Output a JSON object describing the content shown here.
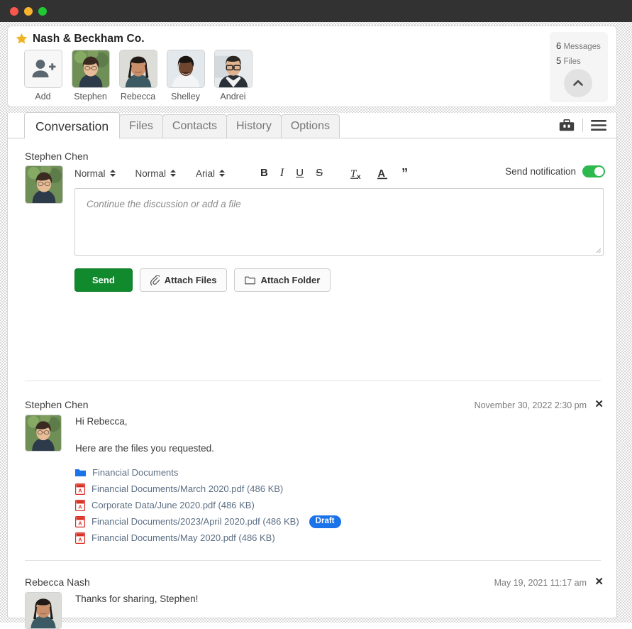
{
  "window": {
    "traffic_lights": [
      "close",
      "minimize",
      "maximize"
    ]
  },
  "header": {
    "star_icon": "star-icon",
    "company_name": "Nash & Beckham Co.",
    "people": [
      {
        "name": "Add",
        "type": "add-button",
        "icon": "add-person-icon"
      },
      {
        "name": "Stephen",
        "type": "avatar"
      },
      {
        "name": "Rebecca",
        "type": "avatar"
      },
      {
        "name": "Shelley",
        "type": "avatar"
      },
      {
        "name": "Andrei",
        "type": "avatar"
      }
    ],
    "counters": {
      "messages_count": "6",
      "messages_label": "Messages",
      "files_count": "5",
      "files_label": "Files",
      "collapse_icon": "chevron-up-icon"
    }
  },
  "tabs": [
    {
      "label": "Conversation",
      "active": true
    },
    {
      "label": "Files",
      "active": false
    },
    {
      "label": "Contacts",
      "active": false
    },
    {
      "label": "History",
      "active": false
    },
    {
      "label": "Options",
      "active": false
    }
  ],
  "tab_actions": {
    "toolbox_icon": "briefcase-icon",
    "menu_icon": "hamburger-menu-icon"
  },
  "composer": {
    "author": "Stephen Chen",
    "avatar_icon": "avatar-stephen",
    "toolbar": {
      "style_select": "Normal",
      "size_select": "Normal",
      "font_select": "Arial",
      "bold": "B",
      "italic": "I",
      "underline": "U",
      "strikethrough": "S",
      "clear_format": "Tx",
      "text_color": "A",
      "quote": "”"
    },
    "send_notification_label": "Send notification",
    "send_notification_on": true,
    "input_placeholder": "Continue the discussion or add a file",
    "input_value": "",
    "buttons": {
      "send": "Send",
      "attach_files": "Attach Files",
      "attach_folder": "Attach Folder"
    }
  },
  "messages": [
    {
      "author": "Stephen Chen",
      "timestamp": "November 30, 2022 2:30 pm",
      "close_icon": "close-icon",
      "lines": [
        "Hi Rebecca,",
        "Here are the files you requested."
      ],
      "attachments": [
        {
          "kind": "folder",
          "label": "Financial Documents",
          "badge": ""
        },
        {
          "kind": "pdf",
          "label": "Financial Documents/March 2020.pdf (486 KB)",
          "badge": ""
        },
        {
          "kind": "pdf",
          "label": "Corporate Data/June 2020.pdf (486 KB)",
          "badge": ""
        },
        {
          "kind": "pdf",
          "label": "Financial Documents/2023/April 2020.pdf (486 KB)",
          "badge": "Draft"
        },
        {
          "kind": "pdf",
          "label": "Financial Documents/May 2020.pdf (486 KB)",
          "badge": ""
        }
      ]
    },
    {
      "author": "Rebecca Nash",
      "timestamp": "May 19, 2021 11:17 am",
      "close_icon": "close-icon",
      "lines": [
        "Thanks for sharing, Stephen!"
      ],
      "attachments": []
    }
  ],
  "colors": {
    "accent_green": "#118a2e",
    "toggle_green": "#2eb94f",
    "badge_blue": "#1a73e8",
    "folder_blue": "#1a73e8",
    "pdf_red": "#d93025",
    "titlebar": "#323232"
  }
}
